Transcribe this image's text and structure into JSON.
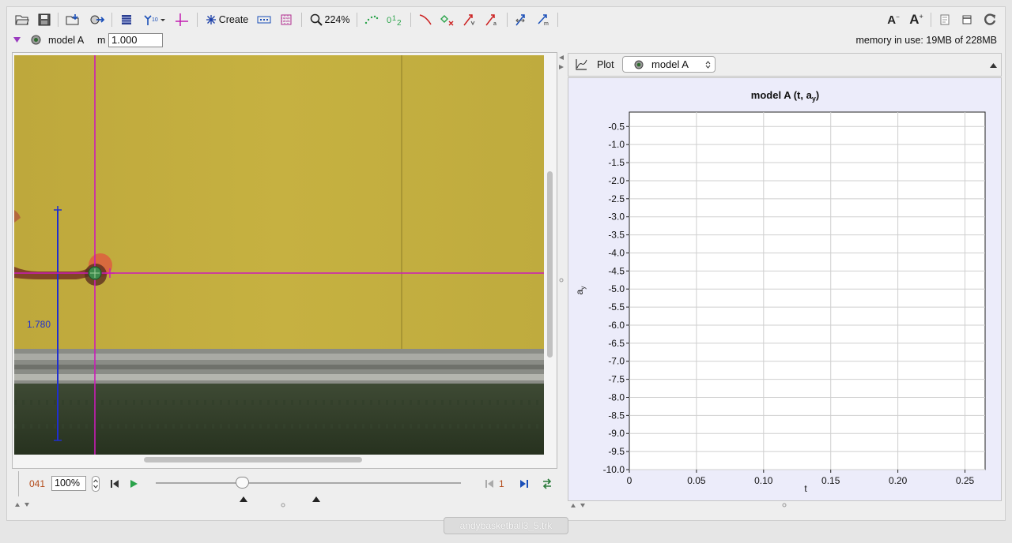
{
  "toolbar": {
    "zoom_label": "224%",
    "create_label": "Create",
    "font_decrease_label": "A",
    "font_increase_label": "A"
  },
  "trackbar": {
    "track_name": "model A",
    "mass_label": "m",
    "mass_value": "1.000",
    "memory_text": "memory in use: 19MB of 228MB"
  },
  "video": {
    "tape_measure_value": "1.780",
    "colors": {
      "wall": "#c2ad40",
      "axes": "#cc1bb8",
      "tape": "#1f2fd0",
      "ball": "#d96a3e"
    }
  },
  "player": {
    "frame_number": "041",
    "zoom_value": "100%",
    "step_size": "1"
  },
  "plot": {
    "view_label": "Plot",
    "selected_track": "model A",
    "chart_data": {
      "type": "line",
      "title": "model A (t, a",
      "title_subscript": "y",
      "title_close": ")",
      "xlabel": "t",
      "ylabel": "a",
      "ylabel_subscript": "y",
      "xlim": [
        0,
        0.265
      ],
      "ylim": [
        -10.0,
        -0.1
      ],
      "x_ticks": [
        "0",
        "0.05",
        "0.10",
        "0.15",
        "0.20",
        "0.25"
      ],
      "x_tick_values": [
        0,
        0.05,
        0.1,
        0.15,
        0.2,
        0.25
      ],
      "y_ticks": [
        "-0.5",
        "-1.0",
        "-1.5",
        "-2.0",
        "-2.5",
        "-3.0",
        "-3.5",
        "-4.0",
        "-4.5",
        "-5.0",
        "-5.5",
        "-6.0",
        "-6.5",
        "-7.0",
        "-7.5",
        "-8.0",
        "-8.5",
        "-9.0",
        "-9.5",
        "-10.0"
      ],
      "y_tick_values": [
        -0.5,
        -1.0,
        -1.5,
        -2.0,
        -2.5,
        -3.0,
        -3.5,
        -4.0,
        -4.5,
        -5.0,
        -5.5,
        -6.0,
        -6.5,
        -7.0,
        -7.5,
        -8.0,
        -8.5,
        -9.0,
        -9.5,
        -10.0
      ],
      "grid": true,
      "series": []
    }
  },
  "file_tab": {
    "label": "andybasketball3_5.trk"
  }
}
